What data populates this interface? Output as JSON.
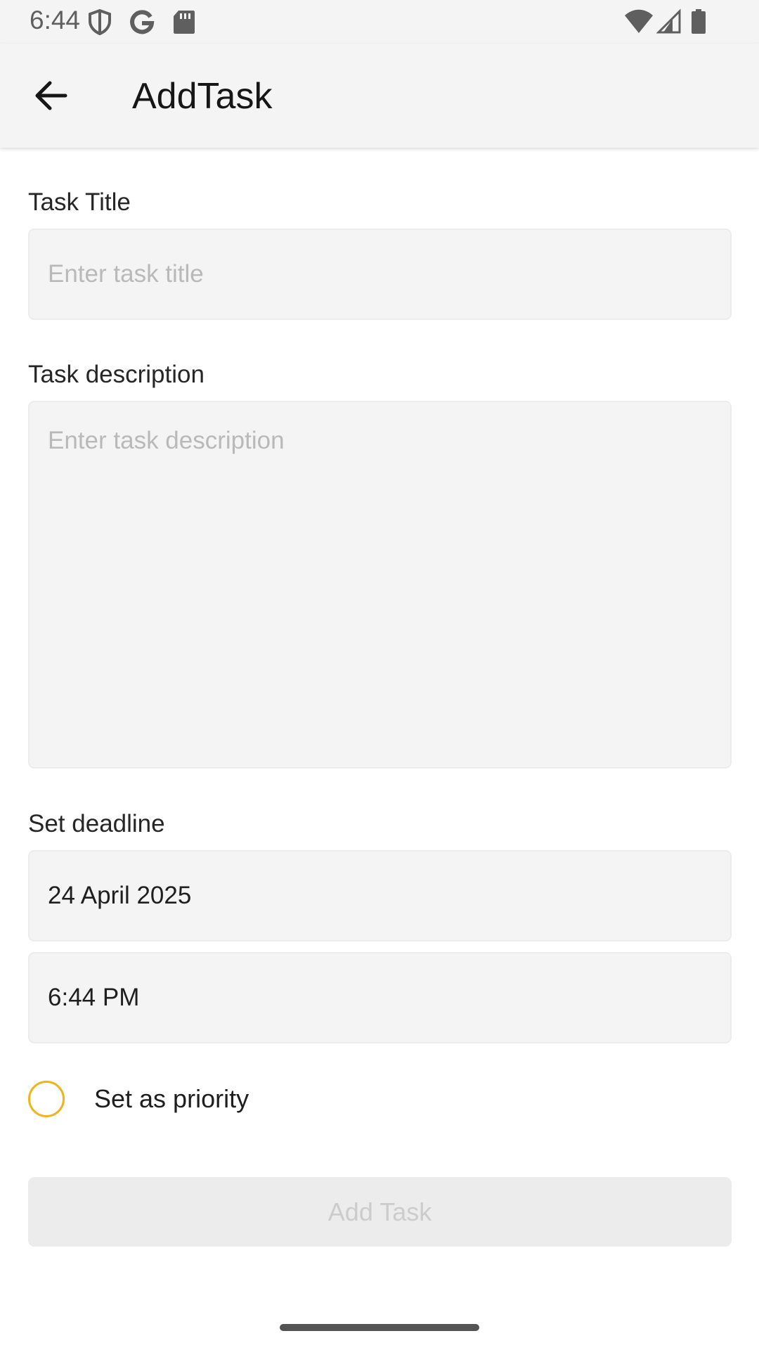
{
  "status_bar": {
    "time": "6:44",
    "icons": [
      "shield-icon",
      "google-icon",
      "sd-card-icon",
      "wifi-icon",
      "signal-icon",
      "battery-icon"
    ]
  },
  "app_bar": {
    "back_icon": "arrow-back-icon",
    "title": "AddTask"
  },
  "form": {
    "title_label": "Task Title",
    "title_placeholder": "Enter task title",
    "title_value": "",
    "description_label": "Task description",
    "description_placeholder": "Enter task description",
    "description_value": "",
    "deadline_label": "Set deadline",
    "deadline_date": "24 April 2025",
    "deadline_time": "6:44 PM",
    "priority_label": "Set as priority",
    "priority_checked": false
  },
  "actions": {
    "add_task_label": "Add Task"
  },
  "colors": {
    "accent": "#f2b21c",
    "field_background": "#f4f4f4",
    "button_disabled_background": "#ececec",
    "button_disabled_text": "#cccccc"
  }
}
